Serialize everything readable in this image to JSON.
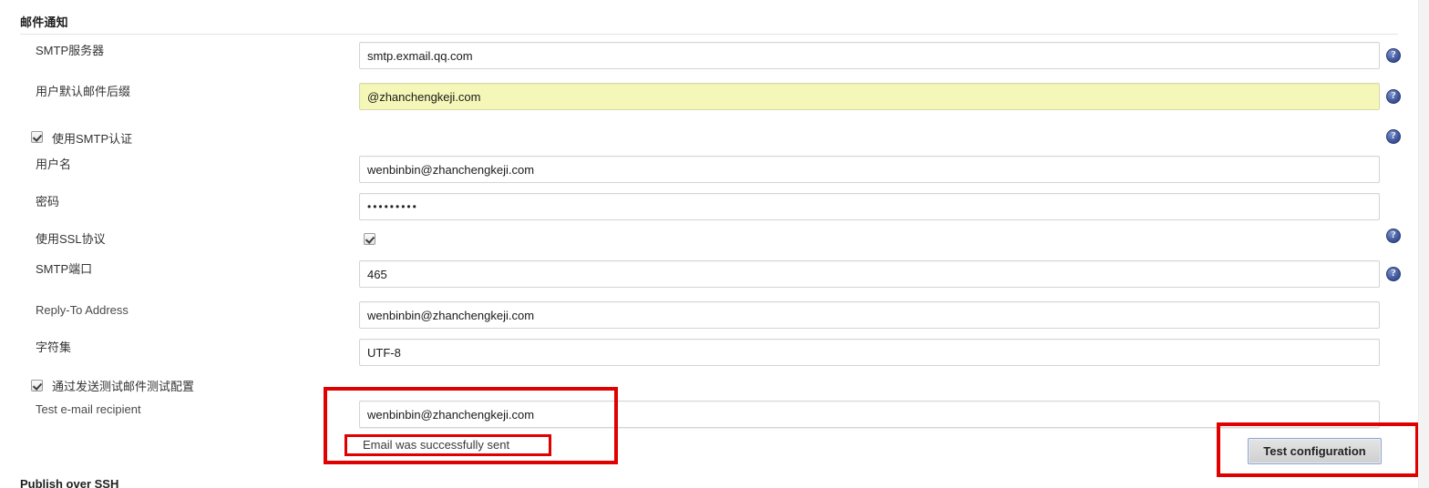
{
  "section": {
    "title": "邮件通知",
    "next_title": "Publish over SSH"
  },
  "fields": {
    "smtp_server": {
      "label": "SMTP服务器",
      "value": "smtp.exmail.qq.com",
      "help_icon": "help-icon"
    },
    "default_suffix": {
      "label": "用户默认邮件后缀",
      "value": "@zhanchengkeji.com",
      "help_icon": "help-icon"
    },
    "use_smtp_auth": {
      "label": "使用SMTP认证",
      "checked": true,
      "help_icon": "help-icon"
    },
    "username": {
      "label": "用户名",
      "value": "wenbinbin@zhanchengkeji.com"
    },
    "password": {
      "label": "密码",
      "value": "•••••••••"
    },
    "use_ssl": {
      "label": "使用SSL协议",
      "checked": true,
      "help_icon": "help-icon"
    },
    "smtp_port": {
      "label": "SMTP端口",
      "value": "465",
      "help_icon": "help-icon"
    },
    "reply_to": {
      "label": "Reply-To Address",
      "value": "wenbinbin@zhanchengkeji.com"
    },
    "charset": {
      "label": "字符集",
      "value": "UTF-8"
    },
    "test_config": {
      "label": "通过发送测试邮件测试配置",
      "checked": true
    },
    "test_recipient": {
      "label": "Test e-mail recipient",
      "value": "wenbinbin@zhanchengkeji.com"
    }
  },
  "status": {
    "email_sent_message": "Email was successfully sent"
  },
  "buttons": {
    "test_configuration": "Test configuration"
  },
  "icons": {
    "help_glyph": "?"
  },
  "colors": {
    "annotation_red": "#e00000",
    "autofill_yellow": "#f5f7b8",
    "help_blue": "#40579d",
    "button_border_blue": "#8ba4cc"
  }
}
